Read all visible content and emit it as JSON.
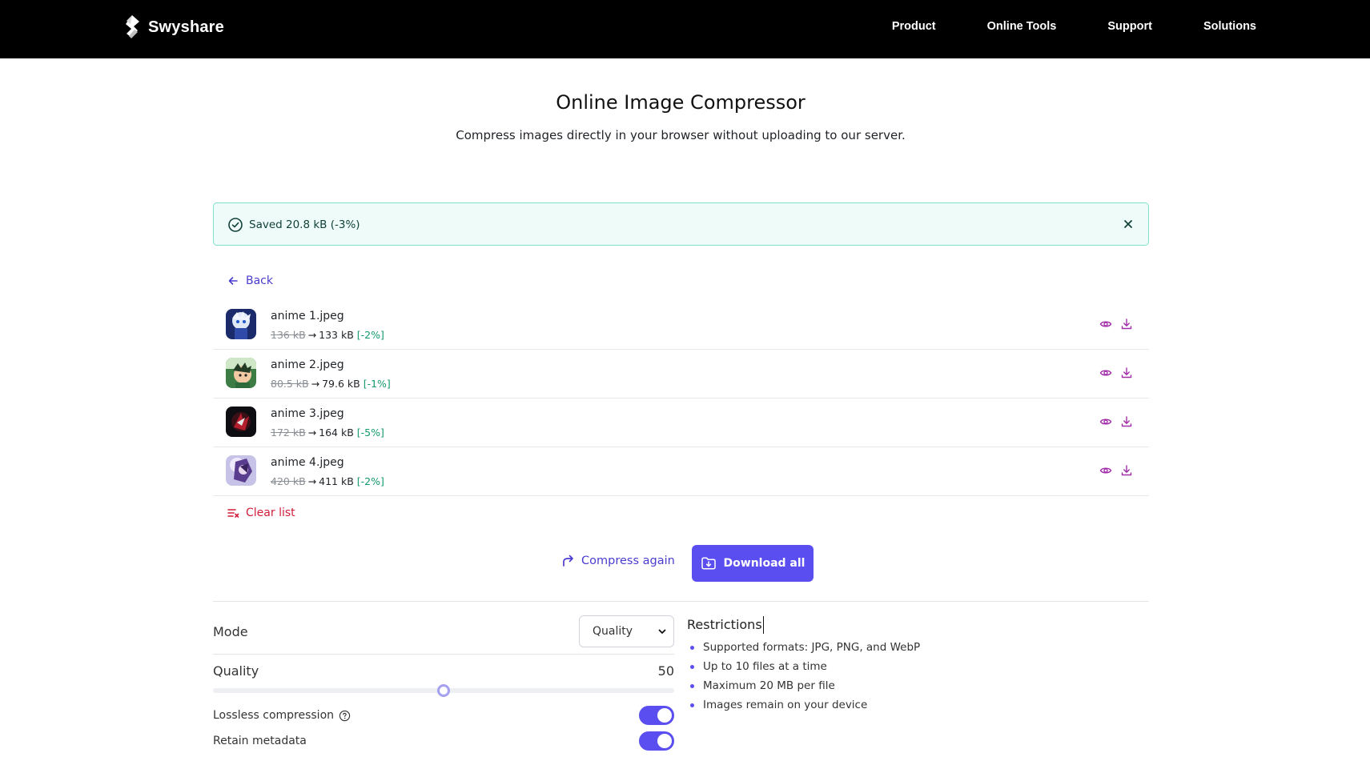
{
  "nav": {
    "brand": "Swyshare",
    "links": [
      "Product",
      "Online Tools",
      "Support",
      "Solutions"
    ]
  },
  "page": {
    "title": "Online Image Compressor",
    "subtitle": "Compress images directly in your browser without uploading to our server."
  },
  "alert": {
    "text": "Saved 20.8 kB (-3%)",
    "status_color": "#13996d"
  },
  "back_label": "Back",
  "files": [
    {
      "name": "anime 1.jpeg",
      "original": "136 kB",
      "compressed": "133 kB",
      "change": "[-2%]"
    },
    {
      "name": "anime 2.jpeg",
      "original": "80.5 kB",
      "compressed": "79.6 kB",
      "change": "[-1%]"
    },
    {
      "name": "anime 3.jpeg",
      "original": "172 kB",
      "compressed": "164 kB",
      "change": "[-5%]"
    },
    {
      "name": "anime 4.jpeg",
      "original": "420 kB",
      "compressed": "411 kB",
      "change": "[-2%]"
    }
  ],
  "arrow": "→",
  "clear_label": "Clear list",
  "actions": {
    "compress_again": "Compress again",
    "download_all": "Download all"
  },
  "settings": {
    "mode_label": "Mode",
    "mode_value": "Quality",
    "quality_label": "Quality",
    "quality_value": "50",
    "quality_fraction": 0.5,
    "lossless_label": "Lossless compression",
    "lossless_on": true,
    "metadata_label": "Retain metadata",
    "metadata_on": true
  },
  "restrictions": {
    "title": "Restrictions",
    "items": [
      "Supported formats: JPG, PNG, and WebP",
      "Up to 10 files at a time",
      "Maximum 20 MB per file",
      "Images remain on your device"
    ]
  },
  "colors": {
    "accent": "#5b4ef0",
    "link": "#4a3ccf",
    "danger": "#d21d3a",
    "success": "#13996d",
    "icon_purple": "#a12ea8"
  }
}
